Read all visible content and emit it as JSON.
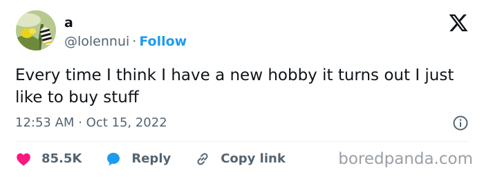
{
  "author": {
    "display_name": "a",
    "handle": "@lolennui",
    "separator": "·",
    "follow_label": "Follow"
  },
  "tweet": {
    "text": "Every time I think I have a new hobby it turns out I just like to buy stuff",
    "time": "12:53 AM",
    "time_separator": "·",
    "date": "Oct 15, 2022"
  },
  "actions": {
    "likes_count": "85.5K",
    "reply_label": "Reply",
    "copy_link_label": "Copy link"
  },
  "watermark": "boredpanda.com",
  "icons": {
    "logo": "x-logo-icon",
    "info": "info-icon",
    "heart": "heart-icon",
    "reply": "reply-bubble-icon",
    "link": "link-icon"
  },
  "colors": {
    "accent": "#1d9bf0",
    "heart": "#f91880",
    "muted": "#536471",
    "text": "#0f1419"
  }
}
